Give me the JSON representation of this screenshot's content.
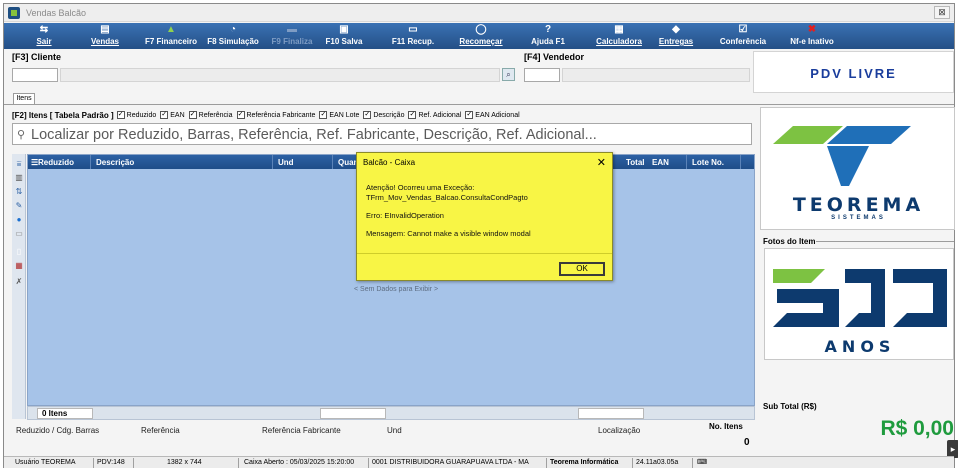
{
  "window": {
    "title": "Vendas Balcão"
  },
  "toolbar": [
    {
      "label": "Sair",
      "icon": "exit-icon",
      "underline": true,
      "disabled": false
    },
    {
      "label": "Vendas",
      "icon": "sales-icon",
      "underline": true,
      "disabled": false
    },
    {
      "label": "F7 Financeiro",
      "icon": "money-icon",
      "underline": false,
      "disabled": false
    },
    {
      "label": "F8 Simulação",
      "icon": "simulation-icon",
      "underline": false,
      "disabled": false
    },
    {
      "label": "F9 Finaliza",
      "icon": "finish-icon",
      "underline": false,
      "disabled": true
    },
    {
      "label": "F10 Salva",
      "icon": "save-icon",
      "underline": false,
      "disabled": false
    },
    {
      "label": "F11 Recup.",
      "icon": "recover-icon",
      "underline": false,
      "disabled": false
    },
    {
      "label": "Recomeçar",
      "icon": "restart-icon",
      "underline": true,
      "disabled": false
    },
    {
      "label": "Ajuda F1",
      "icon": "help-icon",
      "underline": false,
      "disabled": false
    },
    {
      "label": "Calculadora",
      "icon": "calculator-icon",
      "underline": true,
      "disabled": false
    },
    {
      "label": "Entregas",
      "icon": "delivery-icon",
      "underline": true,
      "disabled": false
    },
    {
      "label": "Conferência",
      "icon": "check-icon",
      "underline": false,
      "disabled": false
    },
    {
      "label": "Nf-e Inativo",
      "icon": "close-icon",
      "underline": false,
      "disabled": false
    }
  ],
  "client": {
    "label": "[F3] Cliente",
    "code": "",
    "name": ""
  },
  "vendor": {
    "label": "[F4] Vendedor",
    "code": "",
    "name": ""
  },
  "pdv_mode": "PDV LIVRE",
  "tab": "Itens",
  "filters": {
    "title": "[F2] Itens [ Tabela Padrão ]",
    "options": [
      {
        "label": "Reduzido",
        "checked": true
      },
      {
        "label": "EAN",
        "checked": true
      },
      {
        "label": "Referência",
        "checked": true
      },
      {
        "label": "Referência Fabricante",
        "checked": true
      },
      {
        "label": "EAN Lote",
        "checked": true
      },
      {
        "label": "Descrição",
        "checked": true
      },
      {
        "label": "Ref. Adicional",
        "checked": true
      },
      {
        "label": "EAN Adicional",
        "checked": true
      }
    ]
  },
  "search": {
    "placeholder": "Localizar por Reduzido, Barras, Referência, Ref. Fabricante, Descrição, Ref. Adicional...",
    "value": ""
  },
  "grid": {
    "columns": [
      "Reduzido",
      "Descrição",
      "Und",
      "Quan",
      "Total",
      "EAN",
      "Lote No."
    ],
    "empty_message": "< Sem Dados para Exibir >",
    "footer_count": "0 Itens"
  },
  "bottom_labels": {
    "reduzido": "Reduzido / Cdg. Barras",
    "referencia": "Referência",
    "ref_fabricante": "Referência Fabricante",
    "und": "Und",
    "localizacao": "Localização",
    "no_itens_label": "No. Itens",
    "no_itens_value": "0"
  },
  "logo": {
    "brand": "TEOREMA",
    "tagline": "SISTEMAS"
  },
  "photos": {
    "label": "Fotos do Item",
    "anniversary_text": "ANOS"
  },
  "subtotal": {
    "label": "Sub Total (R$)",
    "value": "R$ 0,00"
  },
  "status_bar": {
    "user": "Usuário TEOREMA",
    "pdv": "PDV:148",
    "resolution": "1382 x 744",
    "cash": "Caixa Aberto : 05/03/2025 15:20:00",
    "company": "0001 DISTRIBUIDORA GUARAPUAVA LTDA - MA",
    "vendor": "Teorema Informática",
    "version": "24.11a03.05a"
  },
  "dialog": {
    "title": "Balcão - Caixa",
    "line1": "Atenção! Ocorreu uma Exceção:",
    "line2": "TFrm_Mov_Vendas_Balcao.ConsultaCondPagto",
    "line3": "Erro: EInvalidOperation",
    "line4": "Mensagem: Cannot make a visible window modal",
    "ok_label": "OK"
  },
  "colors": {
    "toolbar": "#2d61a4",
    "grid_bg": "#a6c3e8",
    "dialog_bg": "#f8f545",
    "subtotal": "#1f9b3e",
    "brand_blue": "#0d3a6e",
    "brand_green": "#7dc242"
  }
}
